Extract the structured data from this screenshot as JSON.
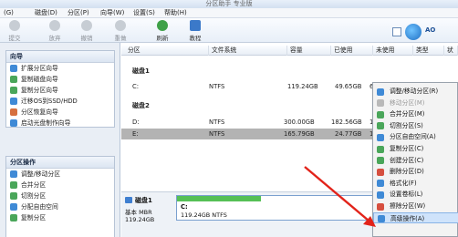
{
  "window": {
    "title": "分区助手 专业版"
  },
  "menu": [
    "磁盘(D)",
    "分区(P)",
    "向导(W)",
    "设置(S)",
    "帮助(H)"
  ],
  "menu_file_fragment": "(G)",
  "toolbar": {
    "buttons": [
      {
        "label": "提交",
        "icon": "check-icon",
        "color": "#c7cdd4"
      },
      {
        "label": "放弃",
        "icon": "undo-icon",
        "color": "#c7cdd4"
      },
      {
        "label": "撤销",
        "icon": "back-icon",
        "color": "#c7cdd4"
      },
      {
        "label": "重做",
        "icon": "redo-icon",
        "color": "#c7cdd4"
      },
      {
        "label": "刷新",
        "icon": "refresh-icon",
        "color": "#3fa148"
      },
      {
        "label": "教程",
        "icon": "book-icon",
        "color": "#3b79c9"
      }
    ],
    "logo_text": "AO"
  },
  "sidebar": {
    "wizard": {
      "title": "向导",
      "items": [
        {
          "label": "扩展分区向导",
          "color": "#3f8ad6"
        },
        {
          "label": "复制磁盘向导",
          "color": "#4aa65a"
        },
        {
          "label": "复制分区向导",
          "color": "#4aa65a"
        },
        {
          "label": "迁移OS到SSD/HDD",
          "color": "#3f8ad6"
        },
        {
          "label": "分区恢复向导",
          "color": "#d6703f"
        },
        {
          "label": "启动光盘制作向导",
          "color": "#3f8ad6"
        }
      ]
    },
    "ops": {
      "title": "分区操作",
      "items": [
        {
          "label": "调整/移动分区",
          "color": "#3f8ad6"
        },
        {
          "label": "合并分区",
          "color": "#4aa65a"
        },
        {
          "label": "切割分区",
          "color": "#4aa65a"
        },
        {
          "label": "分配自由空间",
          "color": "#3f8ad6"
        },
        {
          "label": "复制分区",
          "color": "#4aa65a"
        }
      ]
    }
  },
  "table": {
    "columns": [
      "分区",
      "文件系统",
      "容量",
      "已使用",
      "未使用",
      "类型",
      "状"
    ],
    "disks": [
      {
        "label": "磁盘1",
        "rows": [
          {
            "name": "C:",
            "fs": "NTFS",
            "capacity": "119.24GB",
            "used": "49.65GB",
            "free": "69",
            "selected": false
          }
        ]
      },
      {
        "label": "磁盘2",
        "rows": [
          {
            "name": "D:",
            "fs": "NTFS",
            "capacity": "300.00GB",
            "used": "182.56GB",
            "free": "1",
            "selected": false
          },
          {
            "name": "E:",
            "fs": "NTFS",
            "capacity": "165.79GB",
            "used": "24.77GB",
            "free": "14",
            "selected": true
          }
        ]
      }
    ]
  },
  "diskmap": {
    "title": "磁盘1",
    "type": "基本 MBR",
    "size": "119.24GB",
    "part_name": "C:",
    "part_info": "119.24GB NTFS",
    "used_fraction": 0.42
  },
  "context_menu": {
    "items": [
      {
        "label": "调整/移动分区(R)",
        "disabled": false,
        "color": "#3f8ad6"
      },
      {
        "label": "移动分区(M)",
        "disabled": true,
        "color": "#b9b9b9"
      },
      {
        "label": "合并分区(M)",
        "disabled": false,
        "color": "#4aa65a"
      },
      {
        "label": "切割分区(S)",
        "disabled": false,
        "color": "#4aa65a"
      },
      {
        "label": "分区自由空间(A)",
        "disabled": false,
        "color": "#3f8ad6"
      },
      {
        "label": "复制分区(C)",
        "disabled": false,
        "color": "#4aa65a"
      },
      {
        "label": "创建分区(C)",
        "disabled": false,
        "color": "#4aa65a"
      },
      {
        "label": "删除分区(D)",
        "disabled": false,
        "color": "#d64f3f"
      },
      {
        "label": "格式化(F)",
        "disabled": false,
        "color": "#3f8ad6"
      },
      {
        "label": "设置卷标(L)",
        "disabled": false,
        "color": "#3f8ad6"
      },
      {
        "label": "擦除分区(W)",
        "disabled": false,
        "color": "#d64f3f"
      },
      {
        "label": "高级操作(A)",
        "disabled": false,
        "color": "#3f8ad6",
        "highlighted": true
      }
    ]
  },
  "colors": {
    "accent": "#3b79c9",
    "annotation_arrow": "#e2231a",
    "selected_row": "#b3b3b3"
  }
}
